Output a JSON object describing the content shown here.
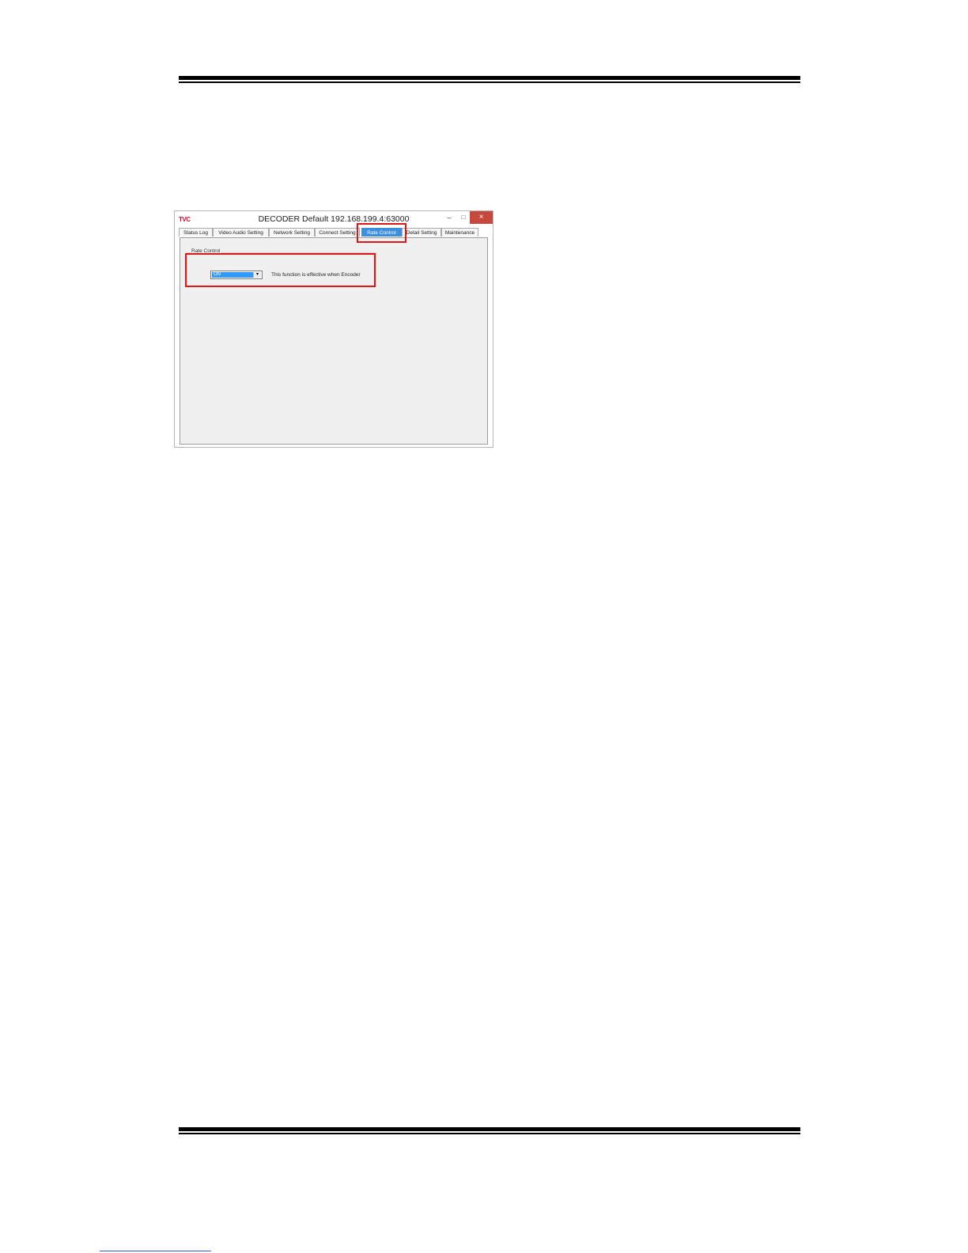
{
  "window": {
    "app_icon_text": "TVC",
    "title": "DECODER Default 192.168.199.4:63000",
    "minimize_glyph": "–",
    "maximize_glyph": "□",
    "close_glyph": "×"
  },
  "tabs": [
    {
      "label": "Status Log"
    },
    {
      "label": "Video Audio Setting"
    },
    {
      "label": "Network Setting"
    },
    {
      "label": "Connect Setting"
    },
    {
      "label": "Rate Control"
    },
    {
      "label": "Detail Setting"
    },
    {
      "label": "Maintenance"
    }
  ],
  "active_tab": "Rate Control",
  "rate_control": {
    "group_label": "Rate Control",
    "selected_value": "ON",
    "note": "This function is effective when Encoder"
  },
  "colors": {
    "highlight": "#e01616",
    "active_tab": "#3c8fdf",
    "close_button": "#c7483d"
  }
}
